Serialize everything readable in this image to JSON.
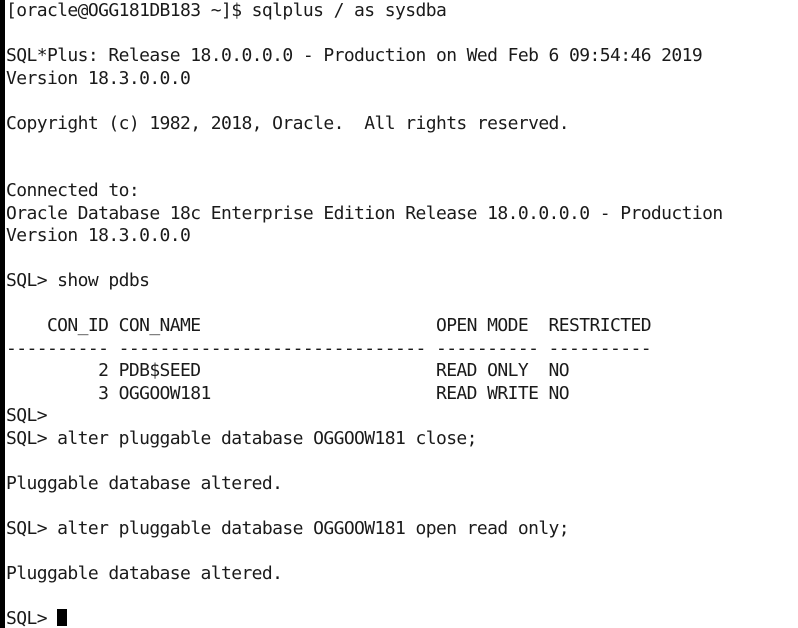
{
  "terminal": {
    "lines": [
      "[oracle@OGG181DB183 ~]$ sqlplus / as sysdba",
      "",
      "SQL*Plus: Release 18.0.0.0.0 - Production on Wed Feb 6 09:54:46 2019",
      "Version 18.3.0.0.0",
      "",
      "Copyright (c) 1982, 2018, Oracle.  All rights reserved.",
      "",
      "",
      "Connected to:",
      "Oracle Database 18c Enterprise Edition Release 18.0.0.0.0 - Production",
      "Version 18.3.0.0.0",
      "",
      "SQL> show pdbs",
      "",
      "    CON_ID CON_NAME                       OPEN MODE  RESTRICTED",
      "---------- ------------------------------ ---------- ----------",
      "         2 PDB$SEED                       READ ONLY  NO",
      "         3 OGGOOW181                      READ WRITE NO",
      "SQL>",
      "SQL> alter pluggable database OGGOOW181 close;",
      "",
      "Pluggable database altered.",
      "",
      "SQL> alter pluggable database OGGOOW181 open read only;",
      "",
      "Pluggable database altered.",
      "",
      "SQL> "
    ]
  },
  "colors": {
    "background": "#ffffff",
    "text": "#1a1a1a",
    "cursor": "#000000"
  }
}
